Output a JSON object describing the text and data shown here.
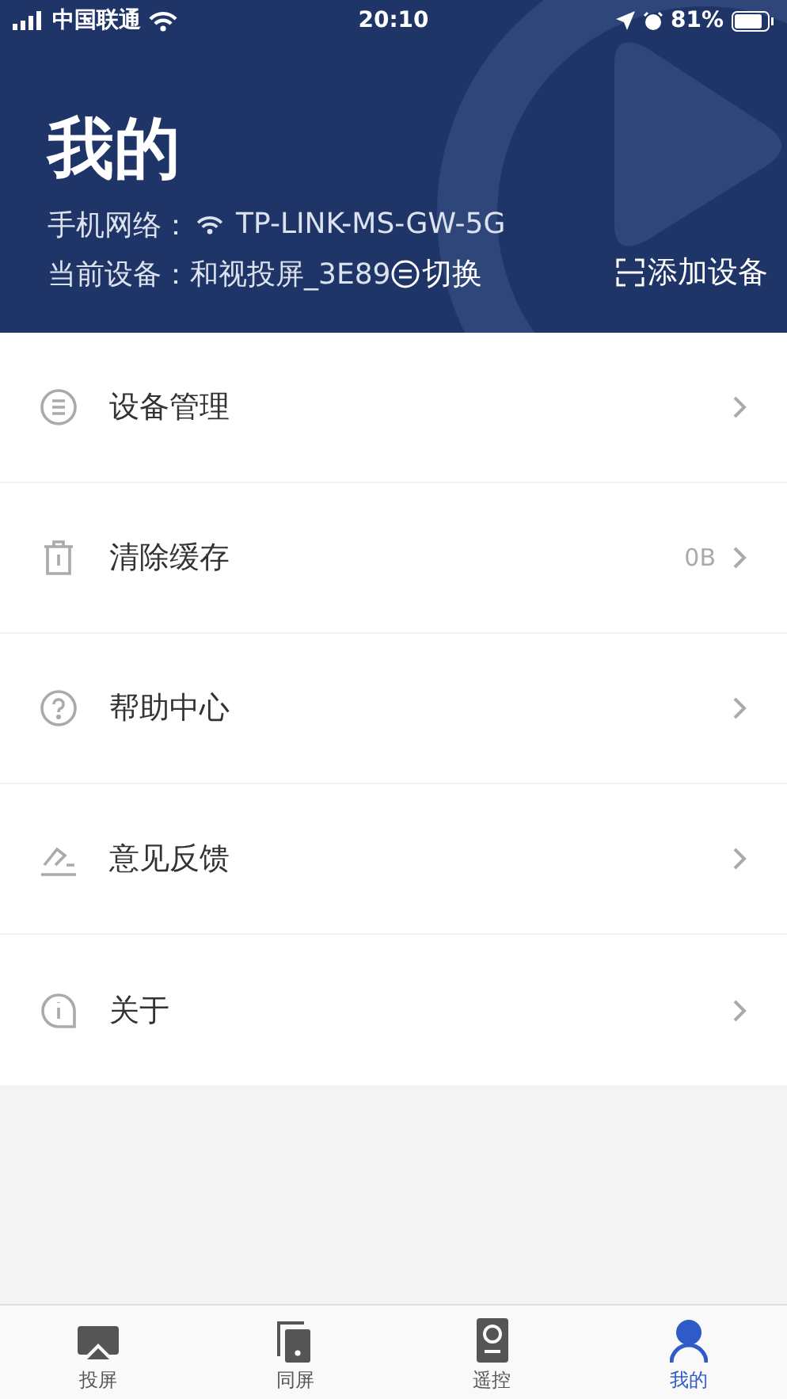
{
  "status_bar": {
    "carrier": "中国联通",
    "time": "20:10",
    "battery": "81%"
  },
  "header": {
    "title": "我的",
    "network_label": "手机网络：",
    "network_name": "TP-LINK-MS-GW-5G",
    "device_label": "当前设备：",
    "device_name": "和视投屏_3E89",
    "switch_label": "切换",
    "add_device_label": "添加设备"
  },
  "menu": [
    {
      "label": "设备管理"
    },
    {
      "label": "清除缓存",
      "value": "0B"
    },
    {
      "label": "帮助中心"
    },
    {
      "label": "意见反馈"
    },
    {
      "label": "关于"
    }
  ],
  "tab_bar": [
    {
      "label": "投屏",
      "selected": false
    },
    {
      "label": "同屏",
      "selected": false
    },
    {
      "label": "遥控",
      "selected": false
    },
    {
      "label": "我的",
      "selected": true
    }
  ]
}
